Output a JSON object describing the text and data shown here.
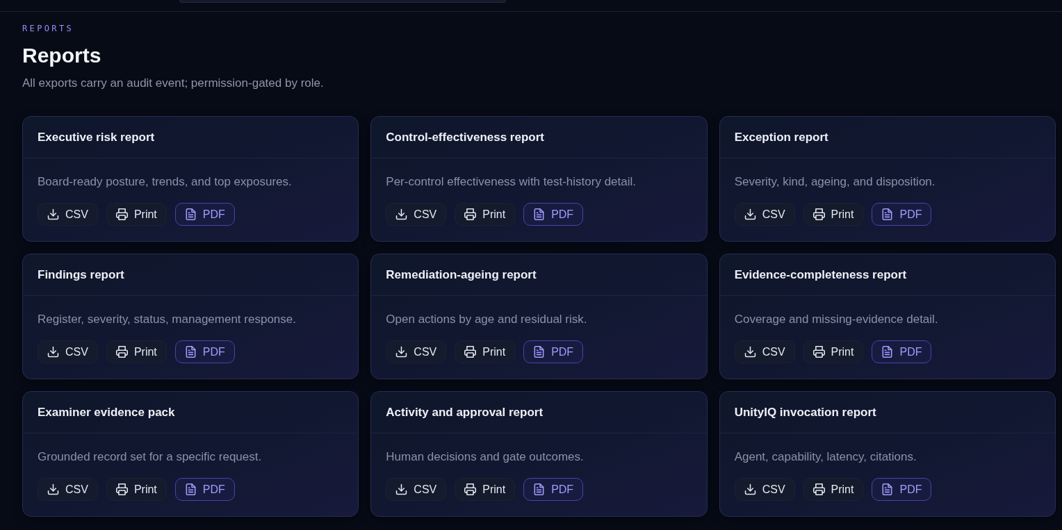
{
  "header": {
    "field": {
      "kind": "field"
    }
  },
  "page": {
    "eyebrow": "REPORTS",
    "title": "Reports",
    "subtitle": "All exports carry an audit event; permission-gated by role."
  },
  "reports": [
    {
      "title": "Executive risk report",
      "description": "Board-ready posture, trends, and top exposures.",
      "actions": [
        {
          "kind": "csv",
          "label": "CSV"
        },
        {
          "kind": "print",
          "label": "Print"
        },
        {
          "kind": "pdf",
          "label": "PDF"
        }
      ]
    },
    {
      "title": "Control-effectiveness report",
      "description": "Per-control effectiveness with test-history detail.",
      "actions": [
        {
          "kind": "csv",
          "label": "CSV"
        },
        {
          "kind": "print",
          "label": "Print"
        },
        {
          "kind": "pdf",
          "label": "PDF"
        }
      ]
    },
    {
      "title": "Exception report",
      "description": "Severity, kind, ageing, and disposition.",
      "actions": [
        {
          "kind": "csv",
          "label": "CSV"
        },
        {
          "kind": "print",
          "label": "Print"
        },
        {
          "kind": "pdf",
          "label": "PDF"
        }
      ]
    },
    {
      "title": "Findings report",
      "description": "Register, severity, status, management response.",
      "actions": [
        {
          "kind": "csv",
          "label": "CSV"
        },
        {
          "kind": "print",
          "label": "Print"
        },
        {
          "kind": "pdf",
          "label": "PDF"
        }
      ]
    },
    {
      "title": "Remediation-ageing report",
      "description": "Open actions by age and residual risk.",
      "actions": [
        {
          "kind": "csv",
          "label": "CSV"
        },
        {
          "kind": "print",
          "label": "Print"
        },
        {
          "kind": "pdf",
          "label": "PDF"
        }
      ]
    },
    {
      "title": "Evidence-completeness report",
      "description": "Coverage and missing-evidence detail.",
      "actions": [
        {
          "kind": "csv",
          "label": "CSV"
        },
        {
          "kind": "print",
          "label": "Print"
        },
        {
          "kind": "pdf",
          "label": "PDF"
        }
      ]
    },
    {
      "title": "Examiner evidence pack",
      "description": "Grounded record set for a specific request.",
      "actions": [
        {
          "kind": "csv",
          "label": "CSV"
        },
        {
          "kind": "print",
          "label": "Print"
        },
        {
          "kind": "pdf",
          "label": "PDF"
        }
      ]
    },
    {
      "title": "Activity and approval report",
      "description": "Human decisions and gate outcomes.",
      "actions": [
        {
          "kind": "csv",
          "label": "CSV"
        },
        {
          "kind": "print",
          "label": "Print"
        },
        {
          "kind": "pdf",
          "label": "PDF"
        }
      ]
    },
    {
      "title": "UnityIQ invocation report",
      "description": "Agent, capability, latency, citations.",
      "actions": [
        {
          "kind": "csv",
          "label": "CSV"
        },
        {
          "kind": "print",
          "label": "Print"
        },
        {
          "kind": "pdf",
          "label": "PDF"
        }
      ]
    }
  ]
}
